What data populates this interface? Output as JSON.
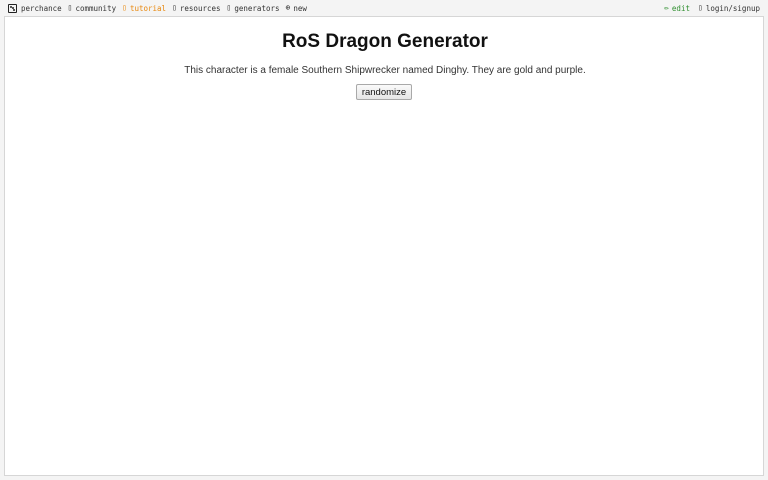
{
  "nav": {
    "left": [
      {
        "label": "perchance",
        "icon": "dice-icon"
      },
      {
        "label": "community",
        "icon": "community-icon"
      },
      {
        "label": "tutorial",
        "icon": "tutorial-icon"
      },
      {
        "label": "resources",
        "icon": "resources-icon"
      },
      {
        "label": "generators",
        "icon": "generators-icon"
      },
      {
        "label": "new",
        "icon": "plus-circle-icon"
      }
    ],
    "right": [
      {
        "label": "edit",
        "icon": "pencil-icon"
      },
      {
        "label": "login/signup",
        "icon": "user-icon"
      }
    ]
  },
  "colors": {
    "accent_tutorial": "#e8870c",
    "accent_edit": "#2f8f2f"
  },
  "main": {
    "title": "RoS Dragon Generator",
    "description": "This character is a female Southern Shipwrecker named Dinghy. They are gold and purple.",
    "button_label": "randomize"
  }
}
